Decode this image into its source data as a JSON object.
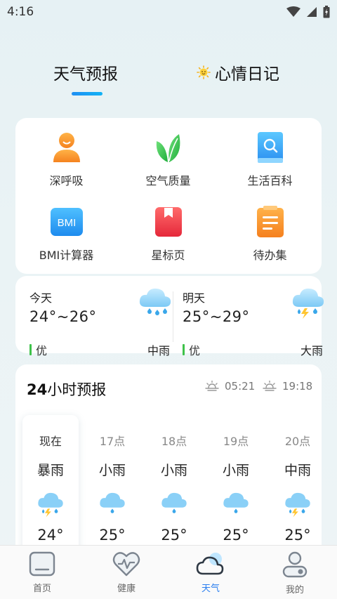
{
  "status_bar": {
    "time": "4:16"
  },
  "top_tabs": {
    "weather": "天气预报",
    "mood": "心情日记"
  },
  "tools": [
    {
      "label": "深呼吸",
      "icon": "person-icon"
    },
    {
      "label": "空气质量",
      "icon": "leaf-icon"
    },
    {
      "label": "生活百科",
      "icon": "encyclopedia-icon"
    },
    {
      "label": "BMI计算器",
      "icon": "bmi-icon",
      "icon_text": "BMI"
    },
    {
      "label": "星标页",
      "icon": "bookmark-icon"
    },
    {
      "label": "待办集",
      "icon": "todo-icon"
    }
  ],
  "forecast": {
    "today": {
      "label": "今天",
      "temp": "24°~26°",
      "aqi": "优",
      "desc": "中雨"
    },
    "tomorrow": {
      "label": "明天",
      "temp": "25°~29°",
      "aqi": "优",
      "desc": "大雨"
    }
  },
  "hourly": {
    "title_num": "24",
    "title_text": "小时预报",
    "sunrise": "05:21",
    "sunset": "19:18",
    "hours": [
      {
        "time": "现在",
        "cond": "暴雨",
        "temp": "24°",
        "icon": "thunderstorm-icon"
      },
      {
        "time": "17点",
        "cond": "小雨",
        "temp": "25°",
        "icon": "light-rain-icon"
      },
      {
        "time": "18点",
        "cond": "小雨",
        "temp": "25°",
        "icon": "light-rain-icon"
      },
      {
        "time": "19点",
        "cond": "小雨",
        "temp": "25°",
        "icon": "light-rain-icon"
      },
      {
        "time": "20点",
        "cond": "中雨",
        "temp": "25°",
        "icon": "thunderstorm-icon"
      }
    ]
  },
  "bottom_nav": [
    {
      "label": "首页"
    },
    {
      "label": "健康"
    },
    {
      "label": "天气",
      "active": true
    },
    {
      "label": "我的"
    }
  ],
  "colors": {
    "accent": "#2b7ff0",
    "aqi_good": "#3ec24a",
    "background": "#e6f1f4"
  }
}
